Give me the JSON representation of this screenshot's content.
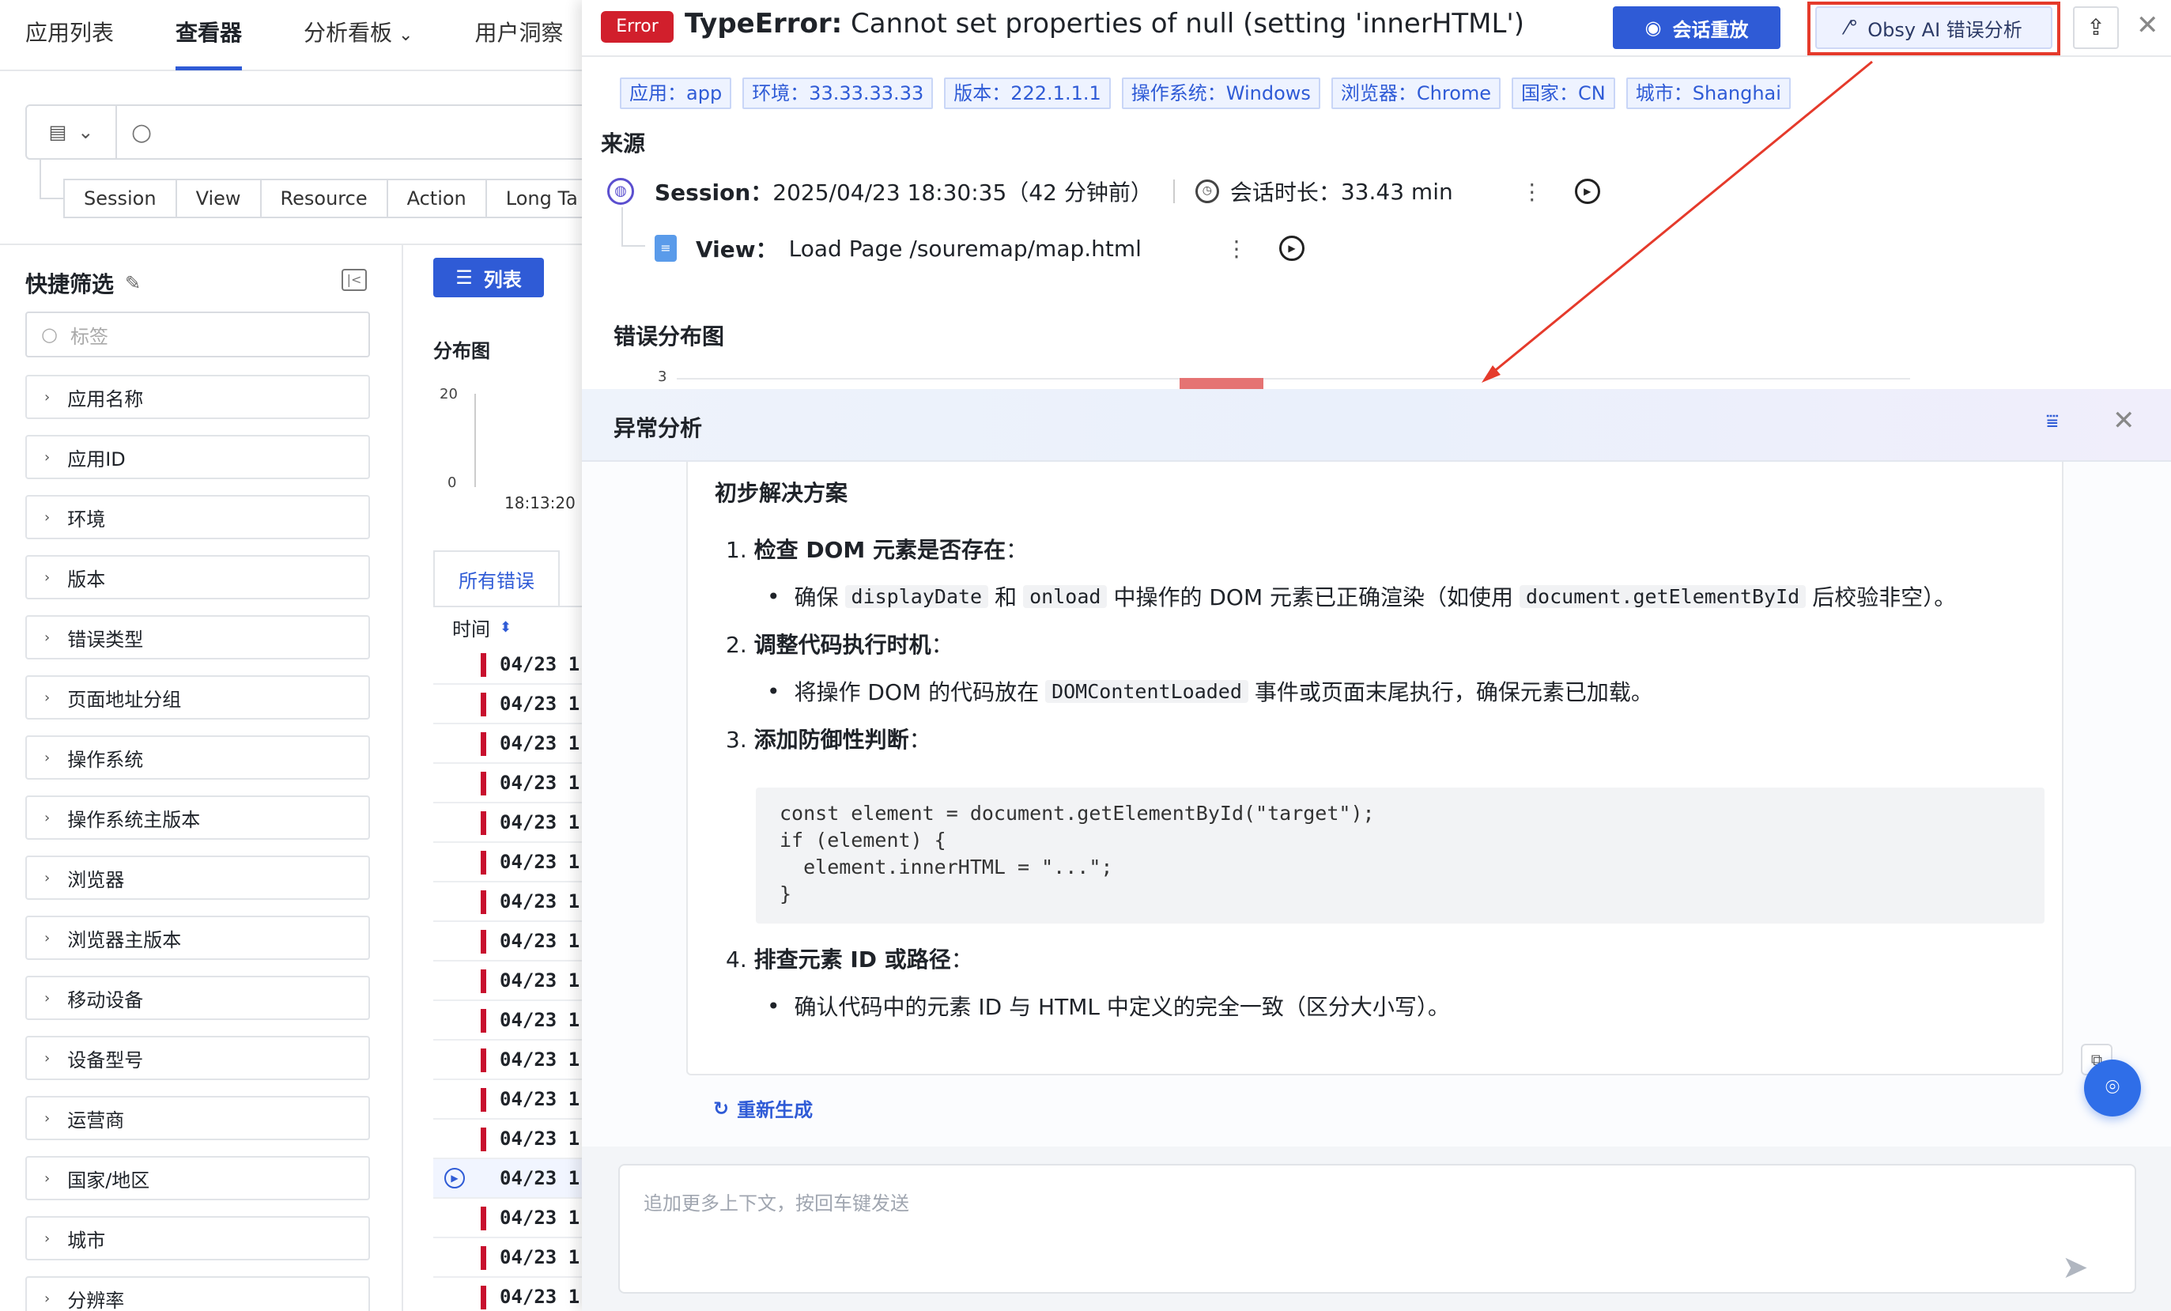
{
  "topnav": {
    "items": [
      {
        "label": "应用列表",
        "active": false,
        "dropdown": false
      },
      {
        "label": "查看器",
        "active": true,
        "dropdown": false
      },
      {
        "label": "分析看板",
        "active": false,
        "dropdown": true
      },
      {
        "label": "用户洞察",
        "active": false,
        "dropdown": false
      }
    ]
  },
  "search": {
    "scope_tabs": [
      "Session",
      "View",
      "Resource",
      "Action",
      "Long Ta"
    ]
  },
  "quick_filter": {
    "title": "快捷筛选",
    "tag_placeholder": "标签",
    "items": [
      "应用名称",
      "应用ID",
      "环境",
      "版本",
      "错误类型",
      "页面地址分组",
      "操作系统",
      "操作系统主版本",
      "浏览器",
      "浏览器主版本",
      "移动设备",
      "设备型号",
      "运营商",
      "国家/地区",
      "城市",
      "分辨率"
    ]
  },
  "main": {
    "list_button": "列表",
    "dist_title": "分布图",
    "mini_chart": {
      "y_max": "20",
      "y_min": "0",
      "x_tick": "18:13:20"
    },
    "error_tab": "所有错误",
    "time_header": "时间",
    "rows": [
      "04/23 1",
      "04/23 1",
      "04/23 1",
      "04/23 1",
      "04/23 1",
      "04/23 1",
      "04/23 1",
      "04/23 1",
      "04/23 1",
      "04/23 1",
      "04/23 1",
      "04/23 1",
      "04/23 1",
      "04/23 1",
      "04/23 1",
      "04/23 1",
      "04/23 1"
    ]
  },
  "drawer": {
    "badge": "Error",
    "error_type": "TypeError:",
    "error_message": "Cannot set properties of null (setting 'innerHTML')",
    "replay_button": "会话重放",
    "ai_button": "Obsy AI 错误分析",
    "tags": [
      "应用：app",
      "环境：33.33.33.33",
      "版本：222.1.1.1",
      "操作系统：Windows",
      "浏览器：Chrome",
      "国家：CN",
      "城市：Shanghai"
    ],
    "source_title": "来源",
    "session_label": "Session：",
    "session_value": "2025/04/23 18:30:35（42 分钟前）",
    "duration_label": "会话时长：",
    "duration_value": "33.43 min",
    "view_label": "View：",
    "view_value": "Load Page /souremap/map.html",
    "errdist_title": "错误分布图",
    "errdist_y_max": "3"
  },
  "analysis": {
    "title": "异常分析",
    "section_title": "初步解决方案",
    "steps": [
      {
        "num": "1.",
        "title": "检查 DOM 元素是否存在",
        "suffix": "："
      },
      {
        "num": "2.",
        "title": "调整代码执行时机",
        "suffix": "："
      },
      {
        "num": "3.",
        "title": "添加防御性判断",
        "suffix": "："
      },
      {
        "num": "4.",
        "title": "排查元素 ID 或路径",
        "suffix": "："
      }
    ],
    "bullet1": {
      "t1": "确保",
      "c1": "displayDate",
      "t2": "和",
      "c2": "onload",
      "t3": "中操作的 DOM 元素已正确渲染（如使用",
      "c3": "document.getElementById",
      "t4": "后校验非空）。"
    },
    "bullet2": {
      "t1": "将操作 DOM 的代码放在",
      "c1": "DOMContentLoaded",
      "t2": "事件或页面末尾执行，确保元素已加载。"
    },
    "code": "const element = document.getElementById(\"target\");\nif (element) {\n  element.innerHTML = \"...\";\n}",
    "bullet4": "确认代码中的元素 ID 与 HTML 中定义的完全一致（区分大小写）。",
    "regen": "重新生成",
    "input_placeholder": "追加更多上下文，按回车键发送"
  }
}
